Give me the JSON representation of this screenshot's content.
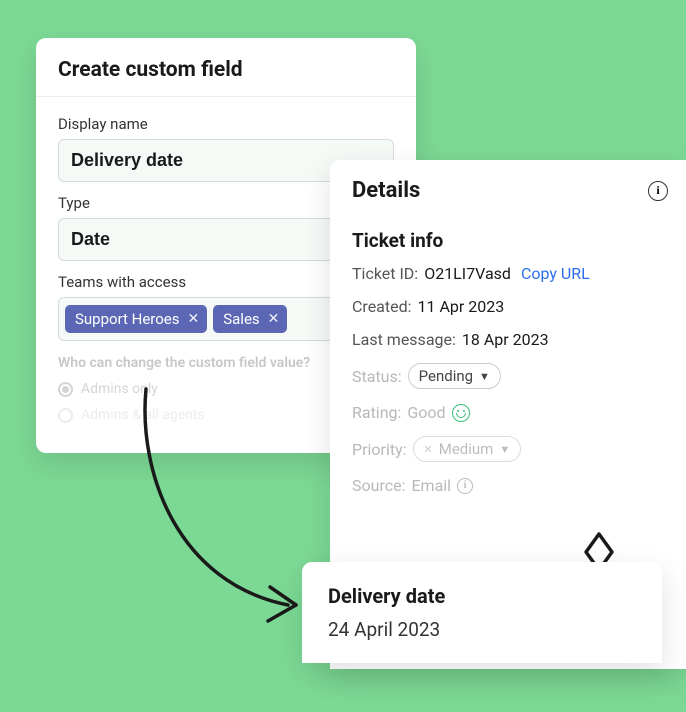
{
  "create": {
    "title": "Create custom field",
    "display_name_label": "Display name",
    "display_name_value": "Delivery date",
    "type_label": "Type",
    "type_value": "Date",
    "teams_label": "Teams with access",
    "teams": [
      {
        "name": "Support Heroes"
      },
      {
        "name": "Sales"
      }
    ],
    "who_question": "Who can change the custom field value?",
    "radio_admins": "Admins only",
    "radio_agents": "Admins & all agents"
  },
  "details": {
    "header": "Details",
    "section_title": "Ticket info",
    "ticket_id_label": "Ticket ID:",
    "ticket_id_value": "O21LI7Vasd",
    "copy_url": "Copy URL",
    "created_label": "Created:",
    "created_value": "11 Apr 2023",
    "last_msg_label": "Last message:",
    "last_msg_value": "18 Apr 2023",
    "status_label": "Status:",
    "status_value": "Pending",
    "rating_label": "Rating:",
    "rating_value": "Good",
    "priority_label": "Priority:",
    "priority_value": "Medium",
    "source_label": "Source:",
    "source_value": "Email"
  },
  "delivery": {
    "title": "Delivery date",
    "value": "24 April 2023"
  }
}
